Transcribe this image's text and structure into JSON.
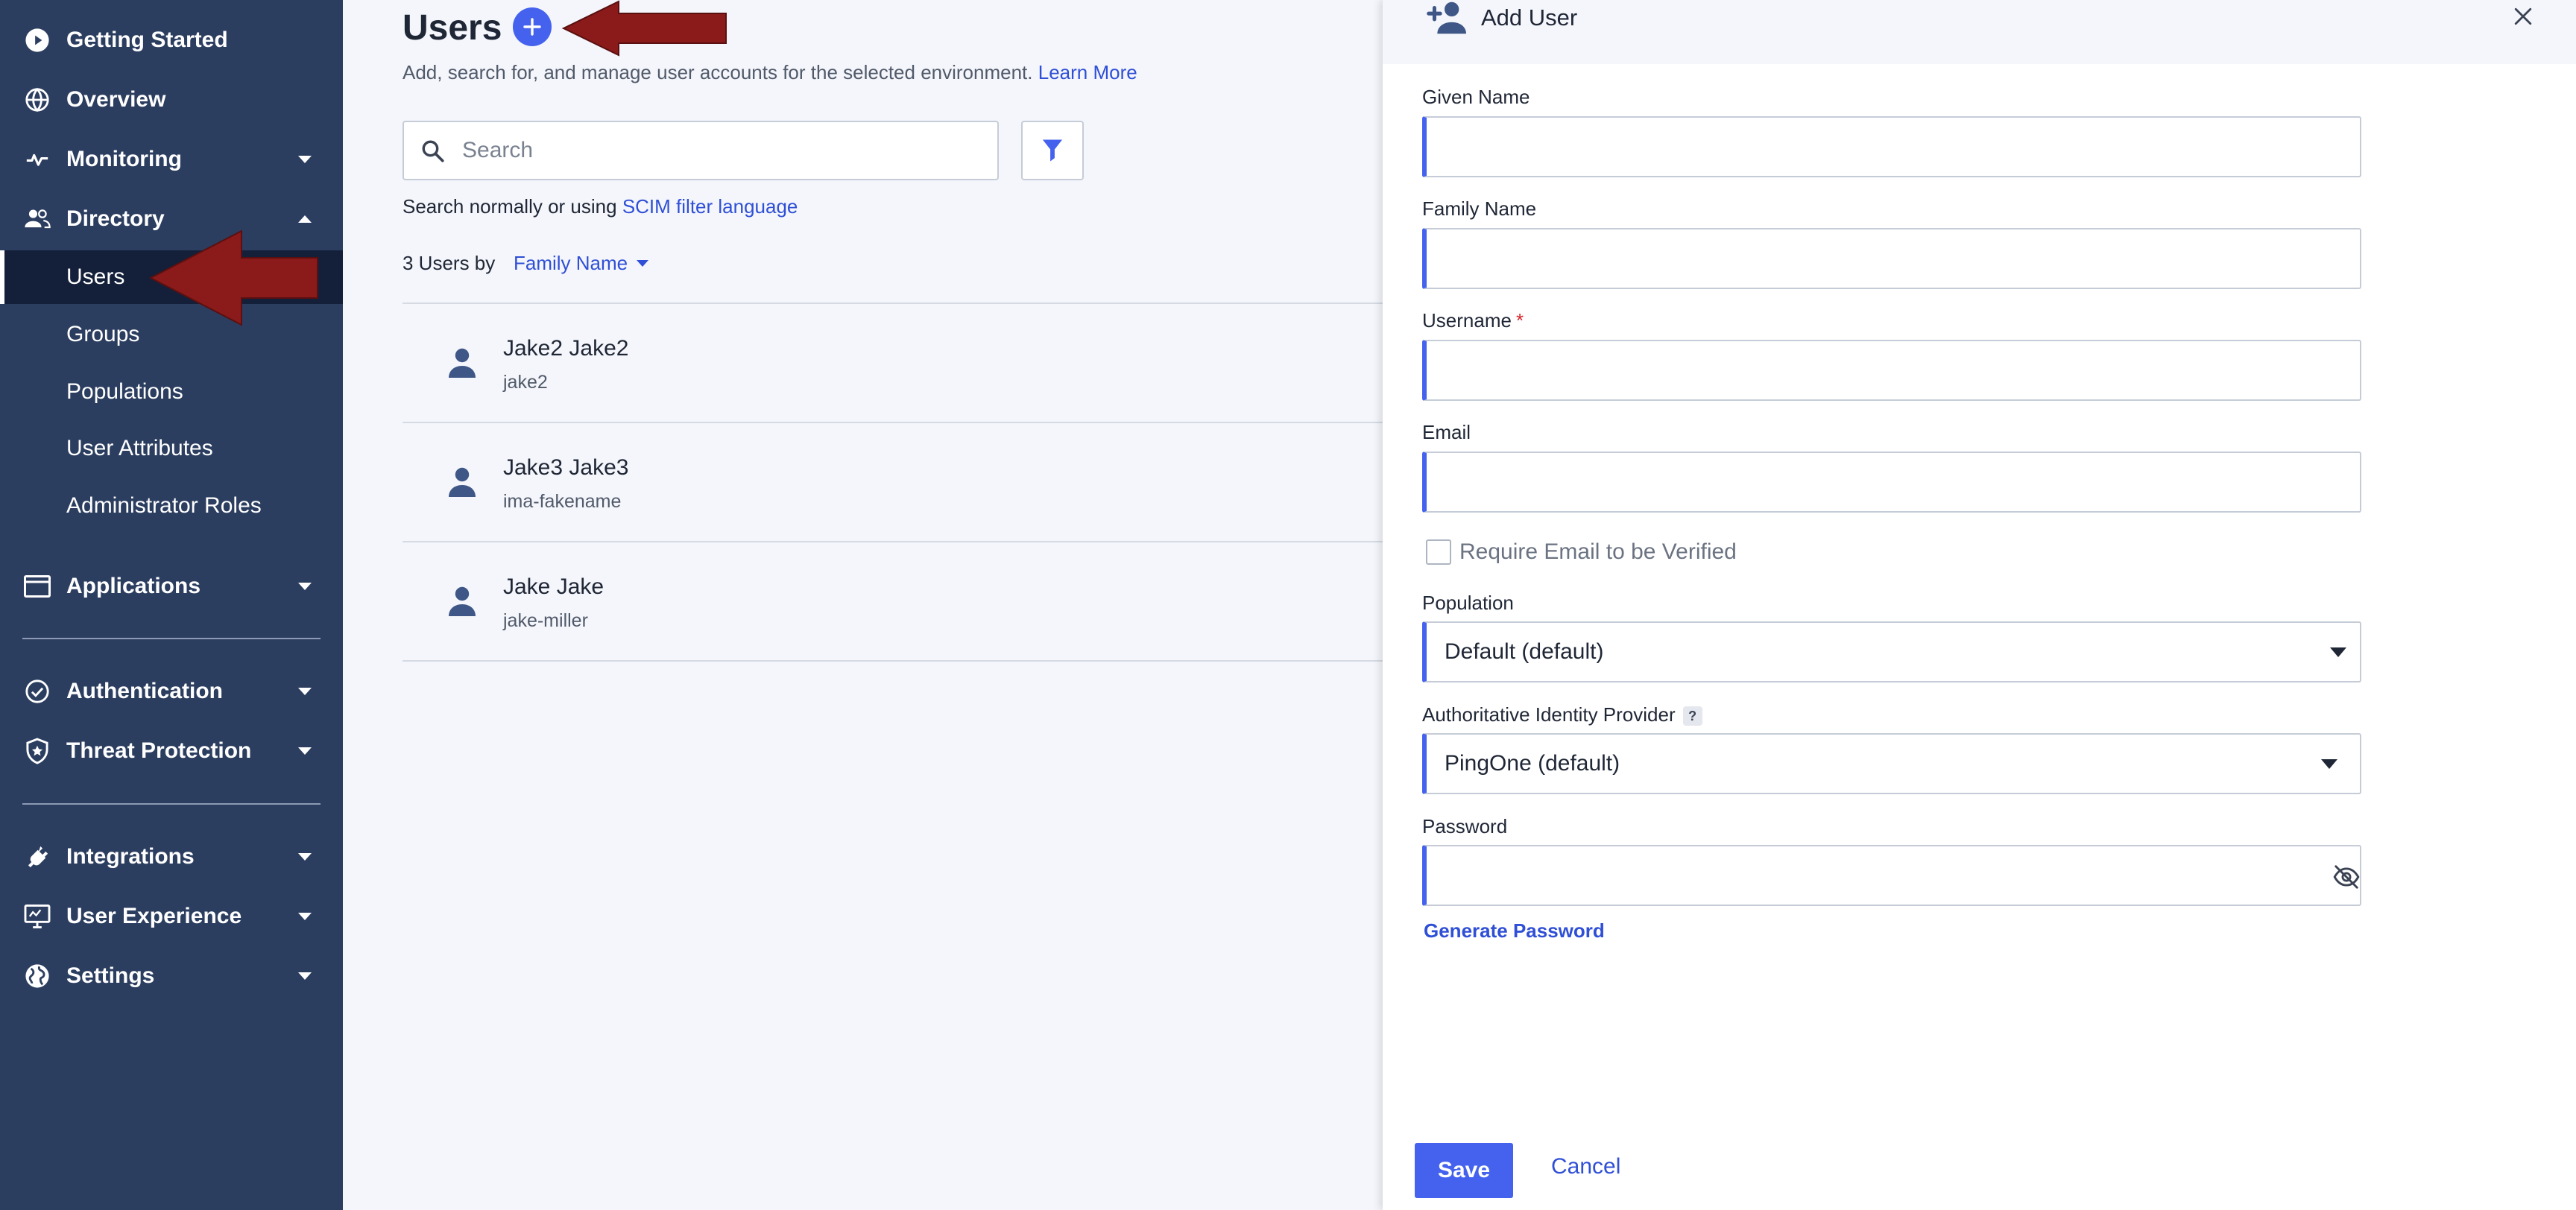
{
  "sidebar": {
    "items": [
      {
        "label": "Getting Started",
        "icon": "play-circle-icon"
      },
      {
        "label": "Overview",
        "icon": "globe-icon"
      },
      {
        "label": "Monitoring",
        "icon": "pulse-icon"
      },
      {
        "label": "Directory",
        "icon": "people-icon"
      },
      {
        "label": "Applications",
        "icon": "window-icon"
      },
      {
        "label": "Authentication",
        "icon": "check-circle-icon"
      },
      {
        "label": "Threat Protection",
        "icon": "shield-star-icon"
      },
      {
        "label": "Integrations",
        "icon": "plug-icon"
      },
      {
        "label": "User Experience",
        "icon": "monitor-icon"
      },
      {
        "label": "Settings",
        "icon": "world-icon"
      }
    ],
    "directory_subitems": [
      "Users",
      "Groups",
      "Populations",
      "User Attributes",
      "Administrator Roles"
    ],
    "active_subitem": "Users"
  },
  "main": {
    "title": "Users",
    "subtitle": "Add, search for, and manage user accounts for the selected environment.",
    "learn_more": "Learn More",
    "search": {
      "placeholder": "Search",
      "value": ""
    },
    "search_hint": "Search normally or using",
    "scim_link": "SCIM filter language",
    "user_count": "3 Users by",
    "sort_by": "Family Name",
    "users": [
      {
        "name": "Jake2 Jake2",
        "username": "jake2"
      },
      {
        "name": "Jake3 Jake3",
        "username": "ima-fakename"
      },
      {
        "name": "Jake Jake",
        "username": "jake-miller"
      }
    ]
  },
  "panel": {
    "title": "Add User",
    "given_name_label": "Given Name",
    "family_name_label": "Family Name",
    "username_label": "Username",
    "required_marker": "*",
    "email_label": "Email",
    "require_verify_label": "Require Email to be Verified",
    "population_label": "Population",
    "population_value": "Default (default)",
    "idp_label": "Authoritative Identity Provider",
    "idp_help": "?",
    "idp_value": "PingOne (default)",
    "password_label": "Password",
    "generate_password": "Generate Password",
    "save_label": "Save",
    "cancel_label": "Cancel"
  },
  "colors": {
    "sidebar_bg": "#2c3e60",
    "sidebar_active": "#14203a",
    "accent": "#4462ed",
    "link": "#2f4fd6",
    "annotation_arrow": "#8b1a1a"
  }
}
